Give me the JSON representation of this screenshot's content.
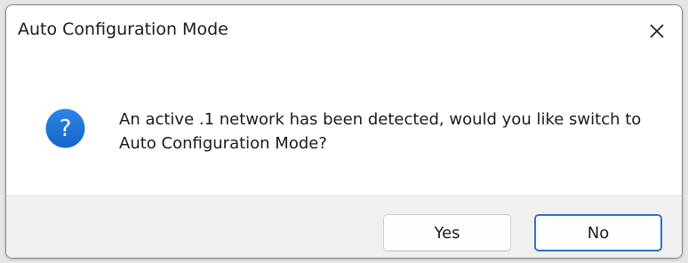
{
  "dialog": {
    "title": "Auto Configuration Mode",
    "close_icon": "close-icon",
    "message": "An active .1 network has been detected, would you like switch to Auto Configuration Mode?",
    "icon": "question-icon",
    "icon_glyph": "?",
    "icon_color": "#1a73d6",
    "buttons": {
      "yes_label": "Yes",
      "no_label": "No"
    },
    "default_button_border_color": "#2f6fd0"
  }
}
